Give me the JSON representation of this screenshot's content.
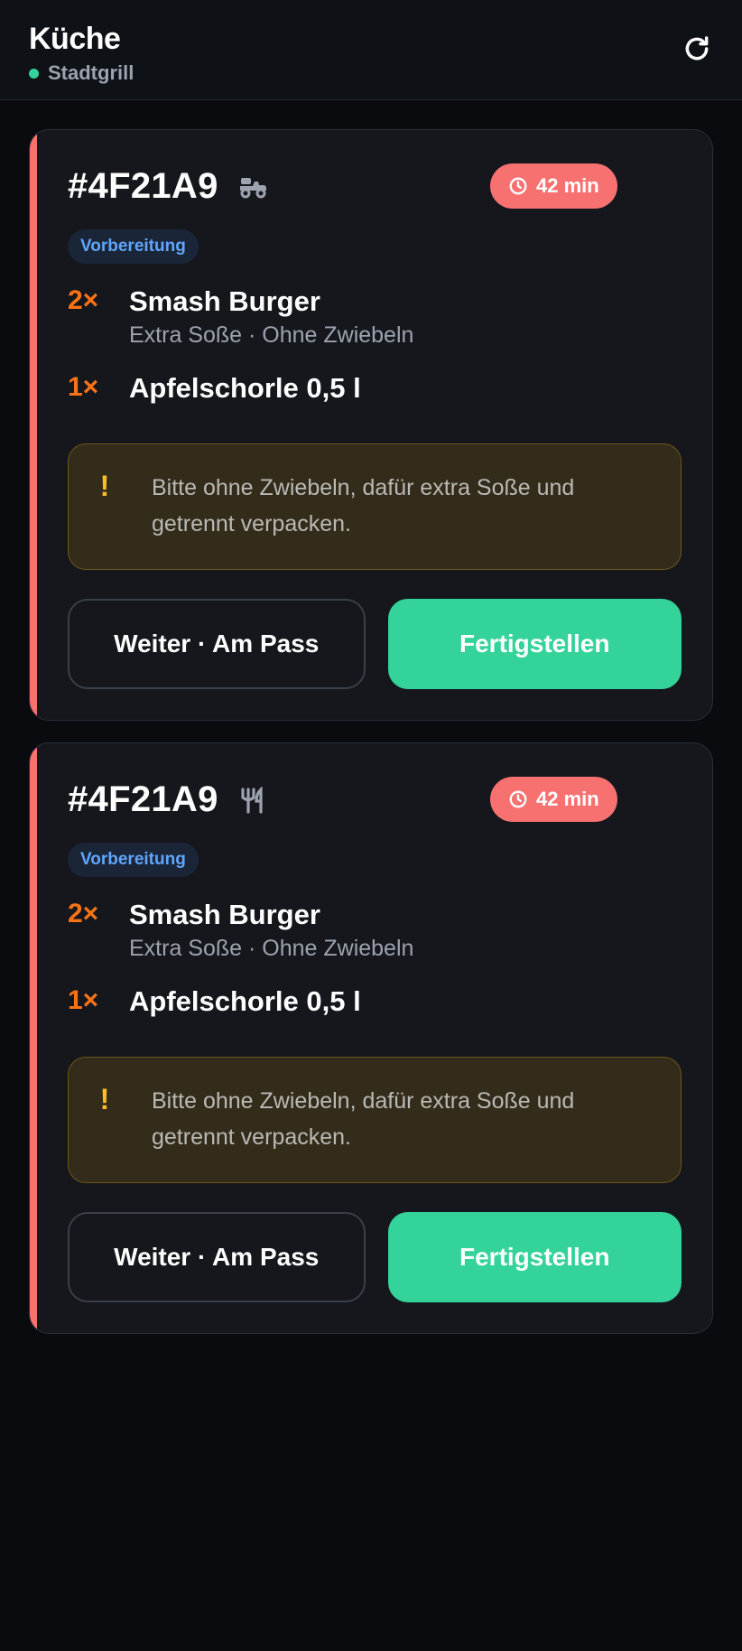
{
  "header": {
    "title": "Küche",
    "location": "Stadtgrill",
    "refresh_icon": "refresh-icon"
  },
  "colors": {
    "accent_late": "#f87171",
    "status_online": "#34d399",
    "primary_button": "#34d399",
    "quantity": "#f97316",
    "note_icon": "#fbbf24",
    "status_badge": "#60a5fa"
  },
  "orders": [
    {
      "id": "#4F21A9",
      "type_icon": "delivery-scooter-icon",
      "timer": "42 min",
      "status": "Vorbereitung",
      "items": [
        {
          "qty": "2×",
          "name": "Smash Burger",
          "mods": "Extra Soße · Ohne Zwiebeln"
        },
        {
          "qty": "1×",
          "name": "Apfelschorle 0,5 l",
          "mods": ""
        }
      ],
      "note": "Bitte ohne Zwiebeln, dafür extra Soße und getrennt verpacken.",
      "secondary_action": "Weiter · Am Pass",
      "primary_action": "Fertigstellen"
    },
    {
      "id": "#4F21A9",
      "type_icon": "dine-in-cutlery-icon",
      "timer": "42 min",
      "status": "Vorbereitung",
      "items": [
        {
          "qty": "2×",
          "name": "Smash Burger",
          "mods": "Extra Soße · Ohne Zwiebeln"
        },
        {
          "qty": "1×",
          "name": "Apfelschorle 0,5 l",
          "mods": ""
        }
      ],
      "note": "Bitte ohne Zwiebeln, dafür extra Soße und getrennt verpacken.",
      "secondary_action": "Weiter · Am Pass",
      "primary_action": "Fertigstellen"
    }
  ]
}
